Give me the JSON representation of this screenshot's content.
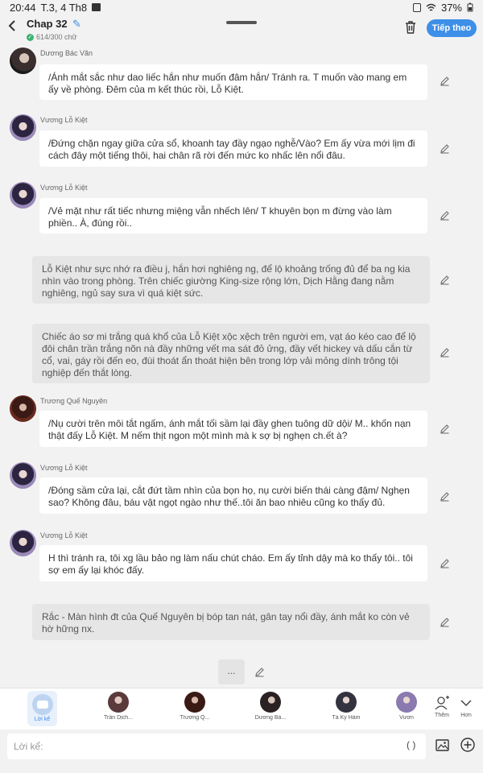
{
  "status_bar": {
    "time": "20:44",
    "date": "T.3, 4 Th8",
    "battery": "37%"
  },
  "header": {
    "title": "Chap 32",
    "word_count": "614/300 chữ",
    "next_label": "Tiếp theo"
  },
  "messages": [
    {
      "type": "dialogue",
      "sender": "Dương Bác Văn",
      "avatar": "av1",
      "text": "/Ánh mắt sắc như dao liếc hắn như muốn đâm hắn/ Tránh ra. T muốn vào mang em ấy về phòng. Đêm của m kết thúc rồi, Lỗ Kiệt."
    },
    {
      "type": "dialogue",
      "sender": "Vương Lỗ Kiệt",
      "avatar": "av2",
      "text": "/Đứng chặn ngay giữa cửa sổ, khoanh tay đầy ngạo nghễ/Vào? Em ấy vừa mới lịm đi cách đây một tiếng thôi, hai chân rã rời đến mức ko nhấc lên nổi đâu."
    },
    {
      "type": "dialogue",
      "sender": "Vương Lỗ Kiệt",
      "avatar": "av2",
      "text": "/Vẻ mặt như rất tiếc nhưng miệng vẫn nhếch lên/ T khuyên bọn m đừng vào làm phiền.. À, đúng rồi.."
    },
    {
      "type": "narration",
      "text": "Lỗ Kiệt như sực nhớ ra điều j, hắn hơi nghiêng ng, để lộ khoảng trống đủ để ba ng kia nhìn vào trong phòng. Trên chiếc giường King-size rộng lớn, Dịch Hằng đang nằm nghiêng, ngủ say sưa vì quá kiệt sức."
    },
    {
      "type": "narration",
      "text": "Chiếc áo sơ mi trắng quá khổ của Lỗ Kiệt xộc xệch trên người em, vạt áo kéo cao để lộ đôi chân trần trắng nõn nà đầy những vết ma sát đỏ ửng, đầy vết hickey và dấu cắn từ cổ, vai, gáy rồi đến eo, đùi thoát ẩn thoát hiện bên trong lớp vải mỏng dính trông tội nghiệp đến thắt lòng."
    },
    {
      "type": "dialogue",
      "sender": "Trương Quế Nguyên",
      "avatar": "av3",
      "text": "/Nụ cười trên môi tắt ngấm, ánh mắt tối sầm lại đầy ghen tuông dữ dội/ M.. khốn nạn thật đấy Lỗ Kiệt. M nếm thịt ngon một mình mà k sợ bị nghẹn ch.ết à?"
    },
    {
      "type": "dialogue",
      "sender": "Vương Lỗ Kiệt",
      "avatar": "av2",
      "text": "/Đóng sầm cửa lại, cắt đứt tầm nhìn của bọn họ, nụ cười biến thái càng đậm/ Nghẹn sao? Không đâu, báu vật ngọt ngào như thế..tôi ăn bao nhiêu cũng ko thấy đủ."
    },
    {
      "type": "dialogue",
      "sender": "Vương Lỗ Kiệt",
      "avatar": "av2",
      "text": "H thì tránh ra, tôi xg lầu bảo ng làm nấu chút cháo. Em ấy tỉnh dậy mà ko thấy tôi.. tôi sợ em ấy lại khóc đấy."
    },
    {
      "type": "narration",
      "text": "Rắc - Màn hình đt của Quế Nguyên bị bóp tan nát, gân tay nổi đầy, ánh mắt ko còn vẻ hờ hững nx."
    }
  ],
  "more_label": "...",
  "characters": {
    "narrator_label": "Lời kể",
    "items": [
      {
        "name": "Trần Dịch...",
        "color": "#5a3a3a"
      },
      {
        "name": "Trương Q...",
        "color": "#3a1a14"
      },
      {
        "name": "Dương Bá...",
        "color": "#2a2222"
      },
      {
        "name": "Tả Kỳ Hàm",
        "color": "#333340"
      },
      {
        "name": "Vươn",
        "color": "#8a7ab0"
      }
    ],
    "theme_label": "Thêm",
    "more_label": "Hơn"
  },
  "input": {
    "placeholder": "Lời kể:",
    "paren": "( )"
  }
}
